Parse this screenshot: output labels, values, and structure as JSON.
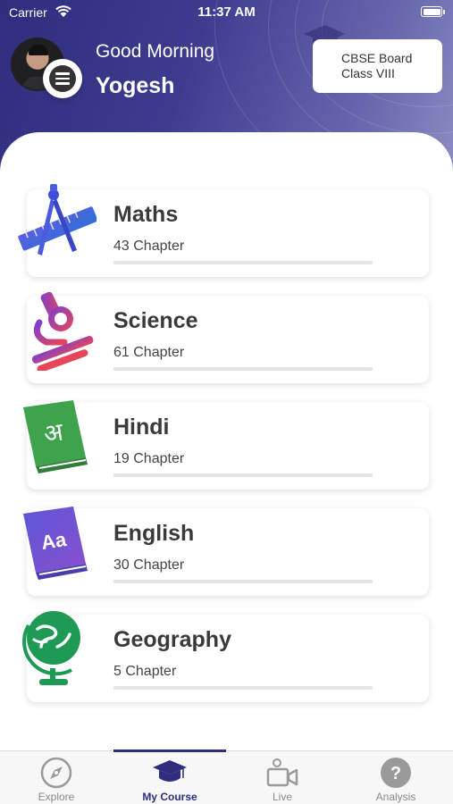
{
  "status_bar": {
    "carrier": "Carrier",
    "time": "11:37 AM"
  },
  "header": {
    "greeting": "Good Morning",
    "user_name": "Yogesh",
    "board": {
      "line1": "CBSE Board",
      "line2": "Class VIII"
    }
  },
  "courses": [
    {
      "name": "Maths",
      "chapters": "43 Chapter",
      "icon": "compass-ruler-icon",
      "progress": 0
    },
    {
      "name": "Science",
      "chapters": "61 Chapter",
      "icon": "microscope-icon",
      "progress": 0
    },
    {
      "name": "Hindi",
      "chapters": "19 Chapter",
      "icon": "hindi-book-icon",
      "icon_text": "अ",
      "progress": 0
    },
    {
      "name": "English",
      "chapters": "30 Chapter",
      "icon": "english-book-icon",
      "icon_text": "Aa",
      "progress": 0
    },
    {
      "name": "Geography",
      "chapters": "5 Chapter",
      "icon": "globe-icon",
      "progress": 0
    }
  ],
  "tabs": [
    {
      "label": "Explore",
      "icon": "compass-icon",
      "active": false
    },
    {
      "label": "My Course",
      "icon": "graduation-cap-icon",
      "active": true
    },
    {
      "label": "Live",
      "icon": "video-camera-icon",
      "active": false
    },
    {
      "label": "Analysis",
      "icon": "question-mark-icon",
      "active": false
    }
  ],
  "colors": {
    "header_start": "#2f2d7d",
    "header_end": "#8c8cc4",
    "accent": "#2f2d7d"
  }
}
